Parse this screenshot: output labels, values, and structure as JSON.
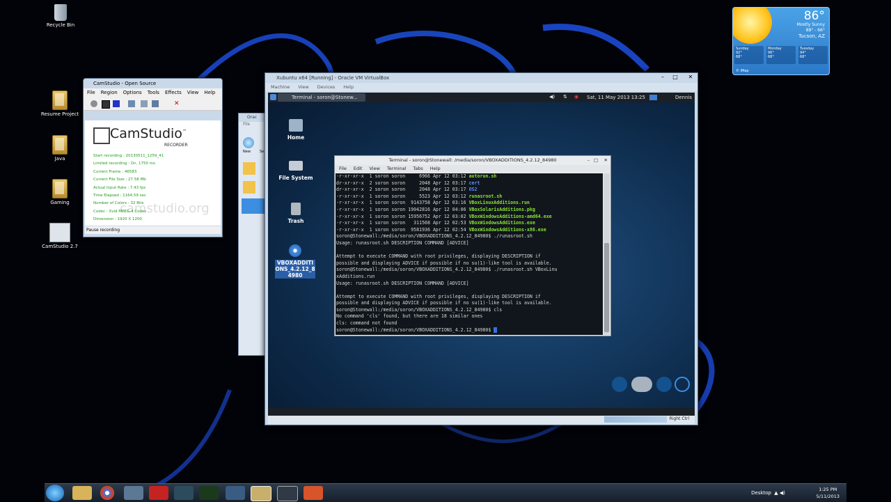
{
  "desktop": {
    "icons": [
      {
        "label": "Recycle Bin"
      },
      {
        "label": "Resume Project"
      },
      {
        "label": "Java"
      },
      {
        "label": "Gaming"
      },
      {
        "label": "CamStudio 2.7"
      }
    ]
  },
  "weather": {
    "temperature": "86°",
    "condition": "Mostly Sunny",
    "range": "88° - 66°",
    "location": "Tucson, AZ",
    "forecast": [
      {
        "day": "Sunday",
        "hi": "92°",
        "lo": "68°"
      },
      {
        "day": "Monday",
        "hi": "96°",
        "lo": "68°"
      },
      {
        "day": "Tuesday",
        "hi": "94°",
        "lo": "68°"
      }
    ],
    "source": "© iMap"
  },
  "camstudio": {
    "title": "CamStudio - Open Source",
    "menu": [
      "File",
      "Region",
      "Options",
      "Tools",
      "Effects",
      "View",
      "Help"
    ],
    "logo": "CamStudio",
    "logo_tm": "™",
    "subtitle": "RECORDER",
    "watermark": "camstudio.org",
    "stats": [
      "Start recording : 20130511_1259_41",
      "Limited recording : On, 1750 ms",
      "Current Frame : 46583",
      "Current File Size : 27.58 Mb",
      "Actual Input Rate : 7.43 fps",
      "Time Elapsed : 1164.59 sec",
      "Number of Colors : 32 Bits",
      "Codec : Xvid MPEG-4 Codec",
      "Dimension : 1920 X 1200"
    ],
    "status": "Pause recording"
  },
  "behind_window": {
    "title": "Orac",
    "menu": "File",
    "new_label": "New",
    "sel_label": "Se"
  },
  "vbox": {
    "title": "Xubuntu x64 [Running] - Oracle VM VirtualBox",
    "menu": [
      "Machine",
      "View",
      "Devices",
      "Help"
    ],
    "status_right": "Right Ctrl"
  },
  "guest": {
    "task": "Terminal - soron@Stonew...",
    "clock": "Sat, 11 May 2013 13:25",
    "user": "Dennis",
    "icons": [
      {
        "label": "Home"
      },
      {
        "label": "File System"
      },
      {
        "label": "Trash"
      },
      {
        "label": "VBOXADDITIONS_4.2.12_84980"
      }
    ]
  },
  "terminal": {
    "title": "Terminal - soron@Stonewall: /media/soron/VBOXADDITIONS_4.2.12_84980",
    "menu": [
      "File",
      "Edit",
      "View",
      "Terminal",
      "Tabs",
      "Help"
    ],
    "listing": [
      {
        "perm": "-r-xr-xr-x  1 soron soron     6966 Apr 12 03:12 ",
        "name": "autorun.sh",
        "kind": "g"
      },
      {
        "perm": "dr-xr-xr-x  2 soron soron     2048 Apr 12 03:17 ",
        "name": "cert",
        "kind": "b"
      },
      {
        "perm": "dr-xr-xr-x  2 soron soron     2048 Apr 12 03:17 ",
        "name": "OS2",
        "kind": "b"
      },
      {
        "perm": "-r-xr-xr-x  1 soron soron     5523 Apr 12 03:12 ",
        "name": "runasroot.sh",
        "kind": "g"
      },
      {
        "perm": "-r-xr-xr-x  1 soron soron  9143758 Apr 12 03:16 ",
        "name": "VBoxLinuxAdditions.run",
        "kind": "g"
      },
      {
        "perm": "-r-xr-xr-x  1 soron soron 19042816 Apr 12 04:06 ",
        "name": "VBoxSolarisAdditions.pkg",
        "kind": "g"
      },
      {
        "perm": "-r-xr-xr-x  1 soron soron 15956752 Apr 12 03:02 ",
        "name": "VBoxWindowsAdditions-amd64.exe",
        "kind": "g"
      },
      {
        "perm": "-r-xr-xr-x  1 soron soron   311568 Apr 12 02:53 ",
        "name": "VBoxWindowsAdditions.exe",
        "kind": "g"
      },
      {
        "perm": "-r-xr-xr-x  1 soron soron  9581936 Apr 12 02:54 ",
        "name": "VBoxWindowsAdditions-x86.exe",
        "kind": "g"
      }
    ],
    "output": [
      "soron@Stonewall:/media/soron/VBOXADDITIONS_4.2.12_84980$ ./runasroot.sh",
      "Usage: runasroot.sh DESCRIPTION COMMAND [ADVICE]",
      "",
      "Attempt to execute COMMAND with root privileges, displaying DESCRIPTION if",
      "possible and displaying ADVICE if possible if no su(1)-like tool is available.",
      "soron@Stonewall:/media/soron/VBOXADDITIONS_4.2.12_84980$ ./runasroot.sh VBoxLinu",
      "xAdditions.run",
      "Usage: runasroot.sh DESCRIPTION COMMAND [ADVICE]",
      "",
      "Attempt to execute COMMAND with root privileges, displaying DESCRIPTION if",
      "possible and displaying ADVICE if possible if no su(1)-like tool is available.",
      "soron@Stonewall:/media/soron/VBOXADDITIONS_4.2.12_84980$ cls",
      "No command 'cls' found, but there are 18 similar ones",
      "cls: command not found",
      "soron@Stonewall:/media/soron/VBOXADDITIONS_4.2.12_84980$ "
    ]
  },
  "taskbar": {
    "desktop_label": "Desktop",
    "time": "1:25 PM",
    "date": "5/11/2013"
  }
}
